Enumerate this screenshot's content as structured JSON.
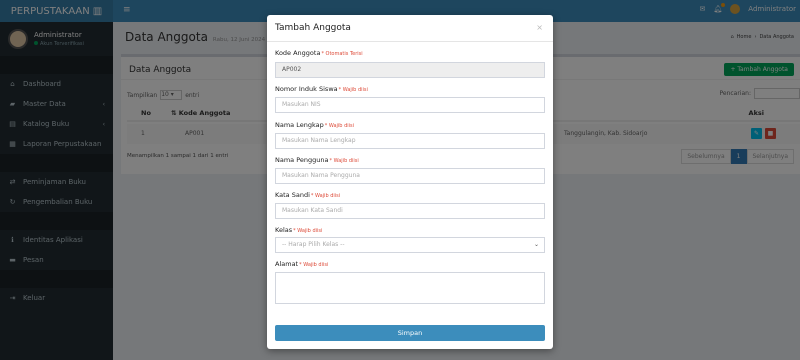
{
  "app": {
    "brand": "PERPUSTAKAAN"
  },
  "topbar": {
    "user": "Administrator"
  },
  "sidebar": {
    "user_name": "Administrator",
    "user_status": "Akun Terverifikasi",
    "items": [
      {
        "label": "Dashboard"
      },
      {
        "label": "Master Data"
      },
      {
        "label": "Katalog Buku"
      },
      {
        "label": "Laporan Perpustakaan"
      },
      {
        "label": "Peminjaman Buku"
      },
      {
        "label": "Pengembalian Buku"
      },
      {
        "label": "Identitas Aplikasi"
      },
      {
        "label": "Pesan"
      },
      {
        "label": "Keluar"
      }
    ]
  },
  "page": {
    "title": "Data Anggota",
    "date": "Rabu, 12 Juni 2024",
    "breadcrumb": [
      "Home",
      "Data Anggota"
    ]
  },
  "table_box": {
    "title": "Data Anggota",
    "add_button": "Tambah Anggota",
    "show_prefix": "Tampilkan",
    "show_value": "10",
    "show_suffix": "entri",
    "search_label": "Pencarian:",
    "headers": {
      "no": "No",
      "kode": "Kode Anggota",
      "aksi": "Aksi"
    },
    "row": {
      "no": "1",
      "kode": "AP001",
      "alamat": "Tanggulangin, Kab. Sidoarjo"
    },
    "info": "Menampilkan 1 sampai 1 dari 1 entri",
    "pager": {
      "prev": "Sebelumnya",
      "page": "1",
      "next": "Selanjutnya"
    }
  },
  "modal": {
    "title": "Tambah Anggota",
    "close": "×",
    "fields": {
      "kode": {
        "label": "Kode Anggota",
        "note": "* Otomatis Terisi",
        "value": "AP002"
      },
      "nis": {
        "label": "Nomor Induk Siswa",
        "note": "* Wajib diisi",
        "placeholder": "Masukan NIS"
      },
      "nama": {
        "label": "Nama Lengkap",
        "note": "* Wajib diisi",
        "placeholder": "Masukan Nama Lengkap"
      },
      "username": {
        "label": "Nama Pengguna",
        "note": "* Wajib diisi",
        "placeholder": "Masukan Nama Pengguna"
      },
      "password": {
        "label": "Kata Sandi",
        "note": "* Wajib diisi",
        "placeholder": "Masukan Kata Sandi"
      },
      "kelas": {
        "label": "Kelas",
        "note": "* Wajib diisi",
        "selected": "-- Harap Pilih Kelas --"
      },
      "alamat": {
        "label": "Alamat",
        "note": "* Wajib diisi"
      }
    },
    "submit": "Simpan"
  }
}
